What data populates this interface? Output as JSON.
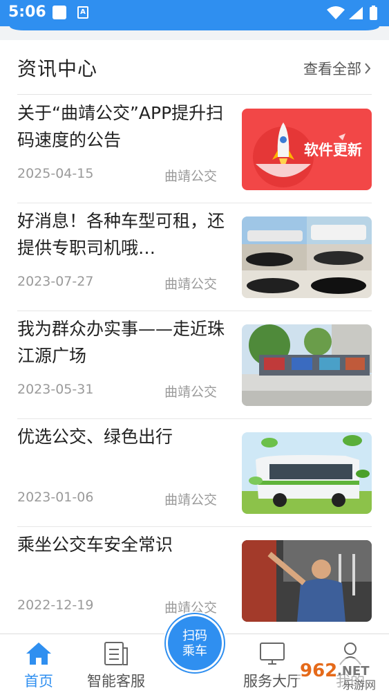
{
  "status_bar": {
    "time": "5:06",
    "notif_letter": "A"
  },
  "section": {
    "title": "资讯中心",
    "see_all": "查看全部"
  },
  "news": [
    {
      "title": "关于“曲靖公交”APP提升扫码速度的公告",
      "date": "2025-04-15",
      "source": "曲靖公交",
      "thumb_text": "软件更新"
    },
    {
      "title": "好消息！各种车型可租，还提供专职司机哦…",
      "date": "2023-07-27",
      "source": "曲靖公交"
    },
    {
      "title": "我为群众办实事——走近珠江源广场",
      "date": "2023-05-31",
      "source": "曲靖公交"
    },
    {
      "title": "优选公交、绿色出行",
      "date": "2023-01-06",
      "source": "曲靖公交"
    },
    {
      "title": "乘坐公交车安全常识",
      "date": "2022-12-19",
      "source": "曲靖公交"
    }
  ],
  "tabbar": {
    "home": "首页",
    "service": "智能客服",
    "scan_line1": "扫码",
    "scan_line2": "乘车",
    "hall": "服务大厅",
    "mine": "我的"
  },
  "watermark": {
    "number": "962",
    "suffix": ".NET",
    "name": "乐游网"
  },
  "colors": {
    "accent": "#2f8ff0",
    "text": "#222222",
    "muted": "#9a9a9a"
  }
}
